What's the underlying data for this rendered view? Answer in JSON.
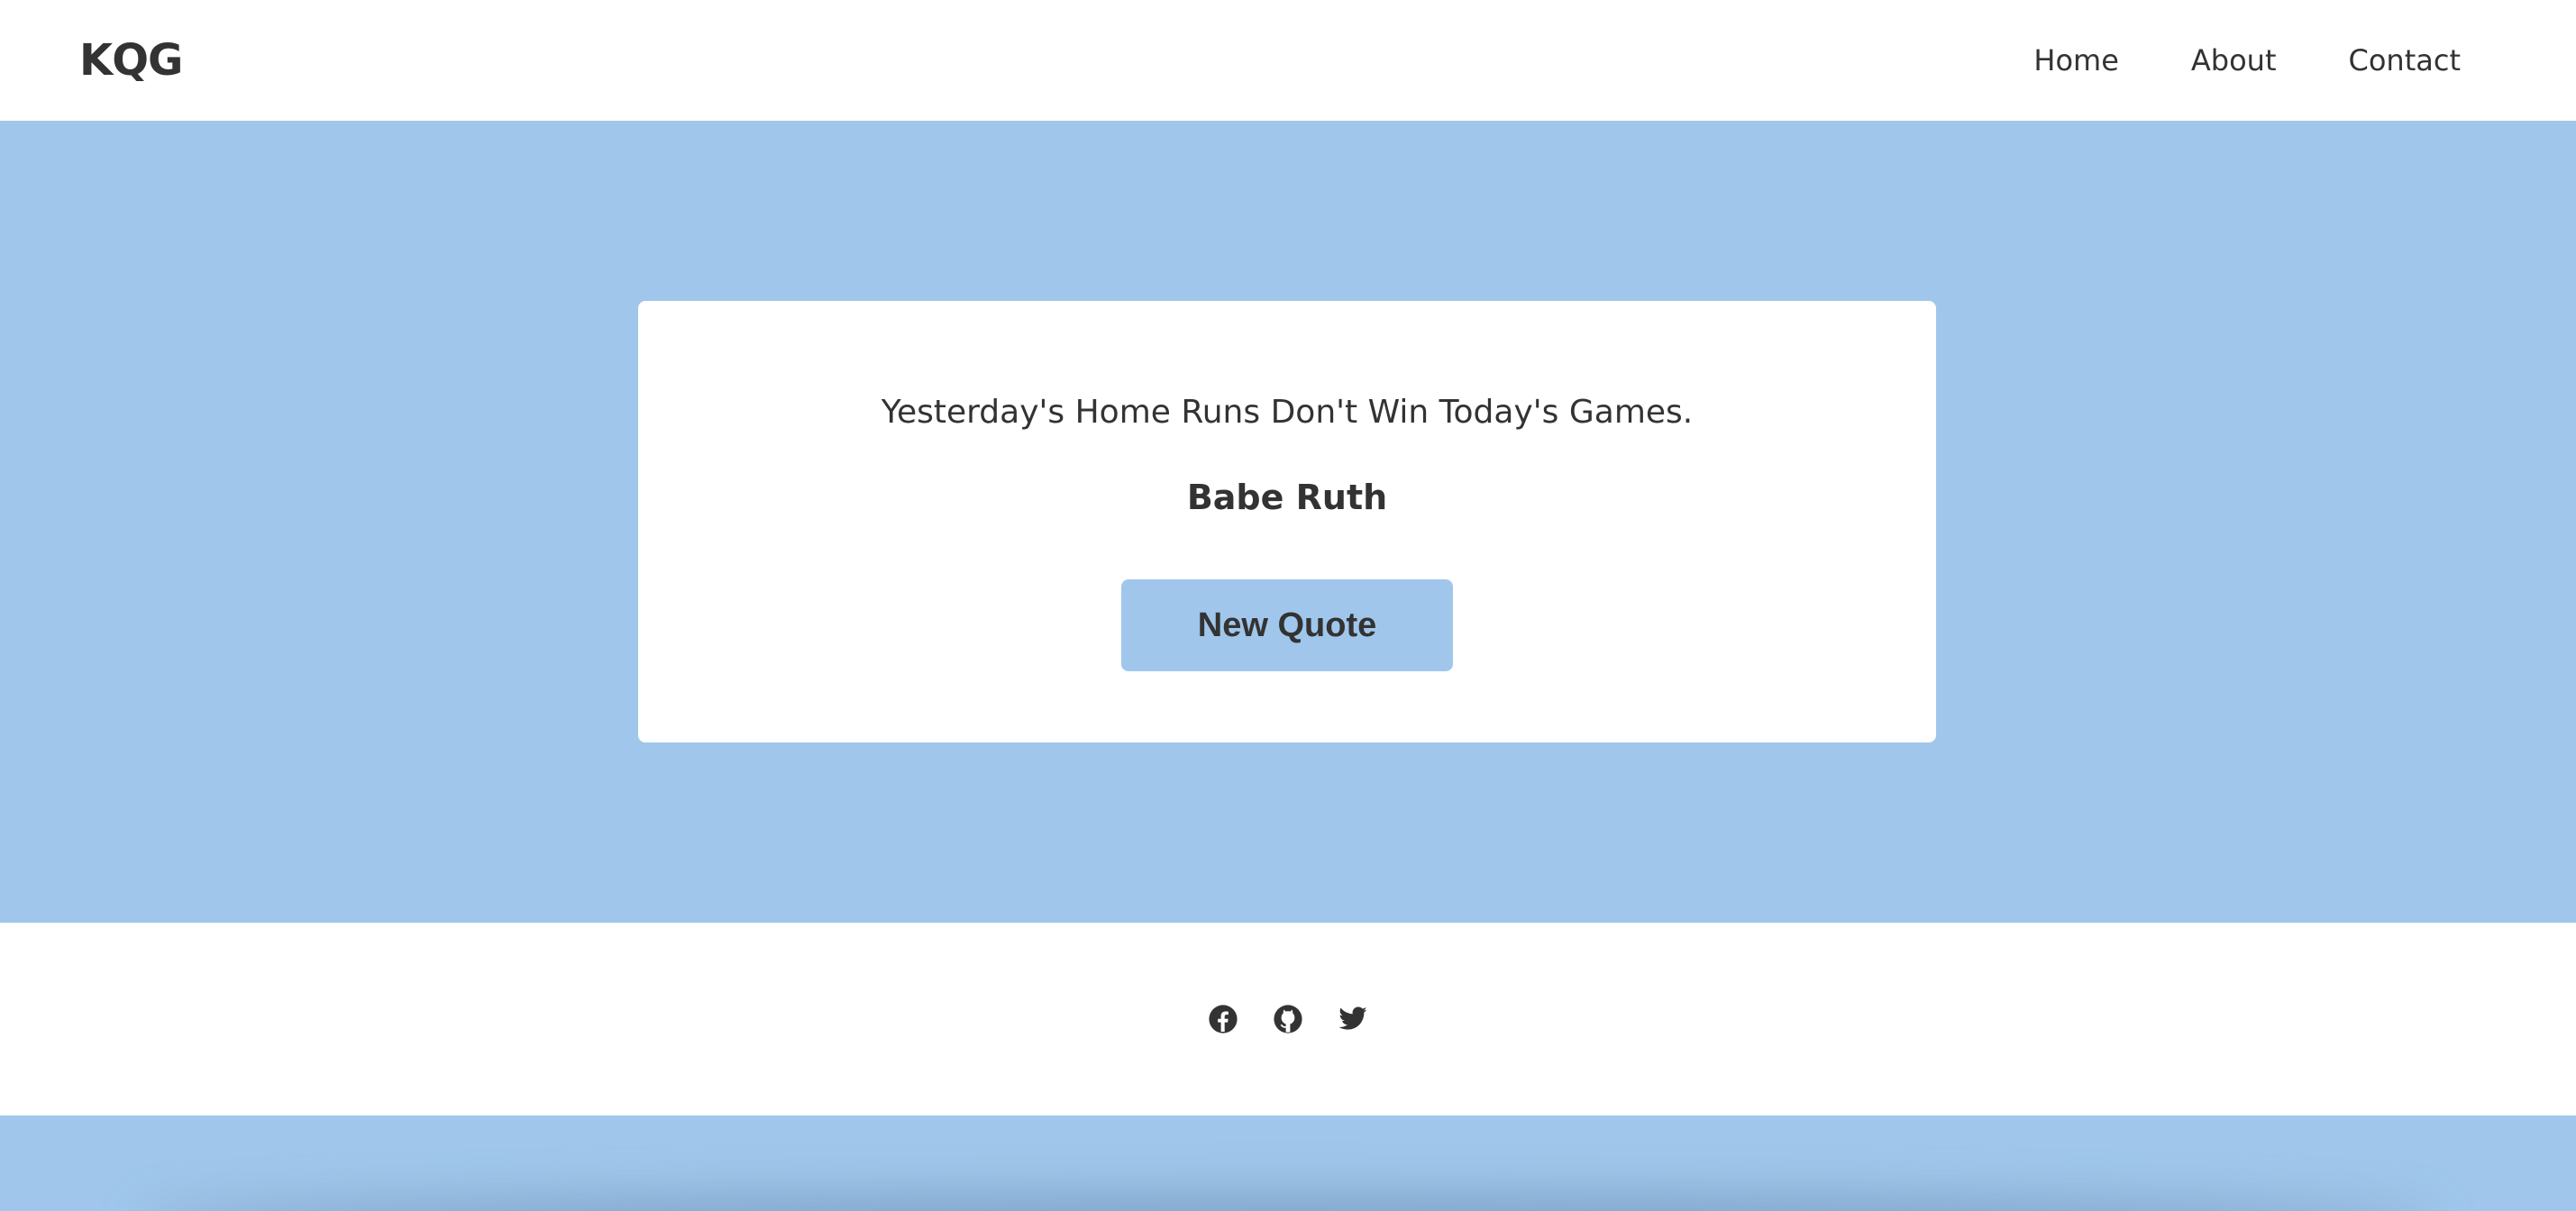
{
  "navbar": {
    "brand": "KQG",
    "links": [
      {
        "label": "Home"
      },
      {
        "label": "About"
      },
      {
        "label": "Contact"
      }
    ]
  },
  "quote": {
    "text": "Yesterday's Home Runs Don't Win Today's Games.",
    "author": "Babe Ruth",
    "button_label": "New Quote"
  },
  "footer": {
    "social": [
      {
        "icon": "facebook-icon"
      },
      {
        "icon": "github-icon"
      },
      {
        "icon": "twitter-icon"
      }
    ]
  },
  "colors": {
    "accent": "#a0c7eb",
    "text": "#333333",
    "background": "#ffffff"
  }
}
